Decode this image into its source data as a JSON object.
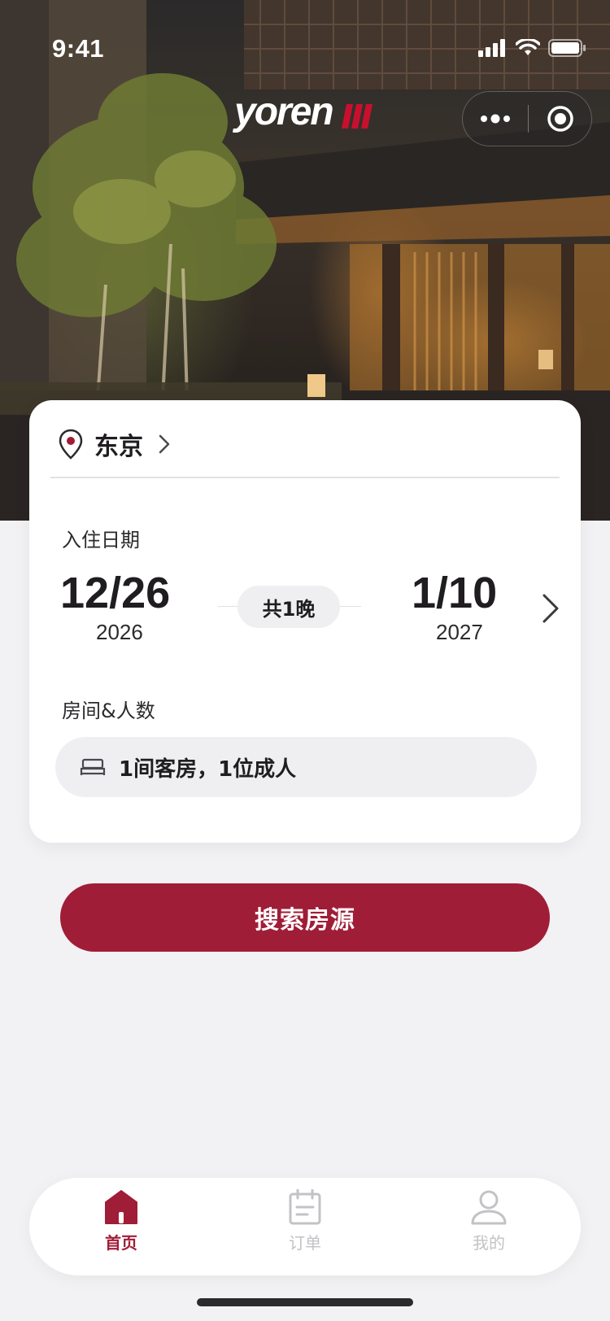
{
  "status_bar": {
    "time": "9:41"
  },
  "brand": {
    "logo_text": "yoren",
    "accent_color": "#a01d37"
  },
  "capsule": {
    "more_icon": "more-dots-icon",
    "close_icon": "target-close-icon"
  },
  "location": {
    "icon": "location-pin-icon",
    "city": "东京",
    "chevron_icon": "chevron-right-icon"
  },
  "dates": {
    "checkin_label": "入住日期",
    "checkin": {
      "day": "12/26",
      "year": "2026"
    },
    "checkout": {
      "day": "1/10",
      "year": "2027"
    },
    "nights": "共1晚"
  },
  "rooms": {
    "label": "房间&人数",
    "icon": "bed-icon",
    "value": "1间客房，1位成人"
  },
  "search_button": {
    "label": "搜索房源"
  },
  "tabbar": {
    "items": [
      {
        "label": "首页",
        "icon": "home-icon",
        "active": true
      },
      {
        "label": "订单",
        "icon": "order-calendar-icon",
        "active": false
      },
      {
        "label": "我的",
        "icon": "profile-icon",
        "active": false
      }
    ]
  }
}
